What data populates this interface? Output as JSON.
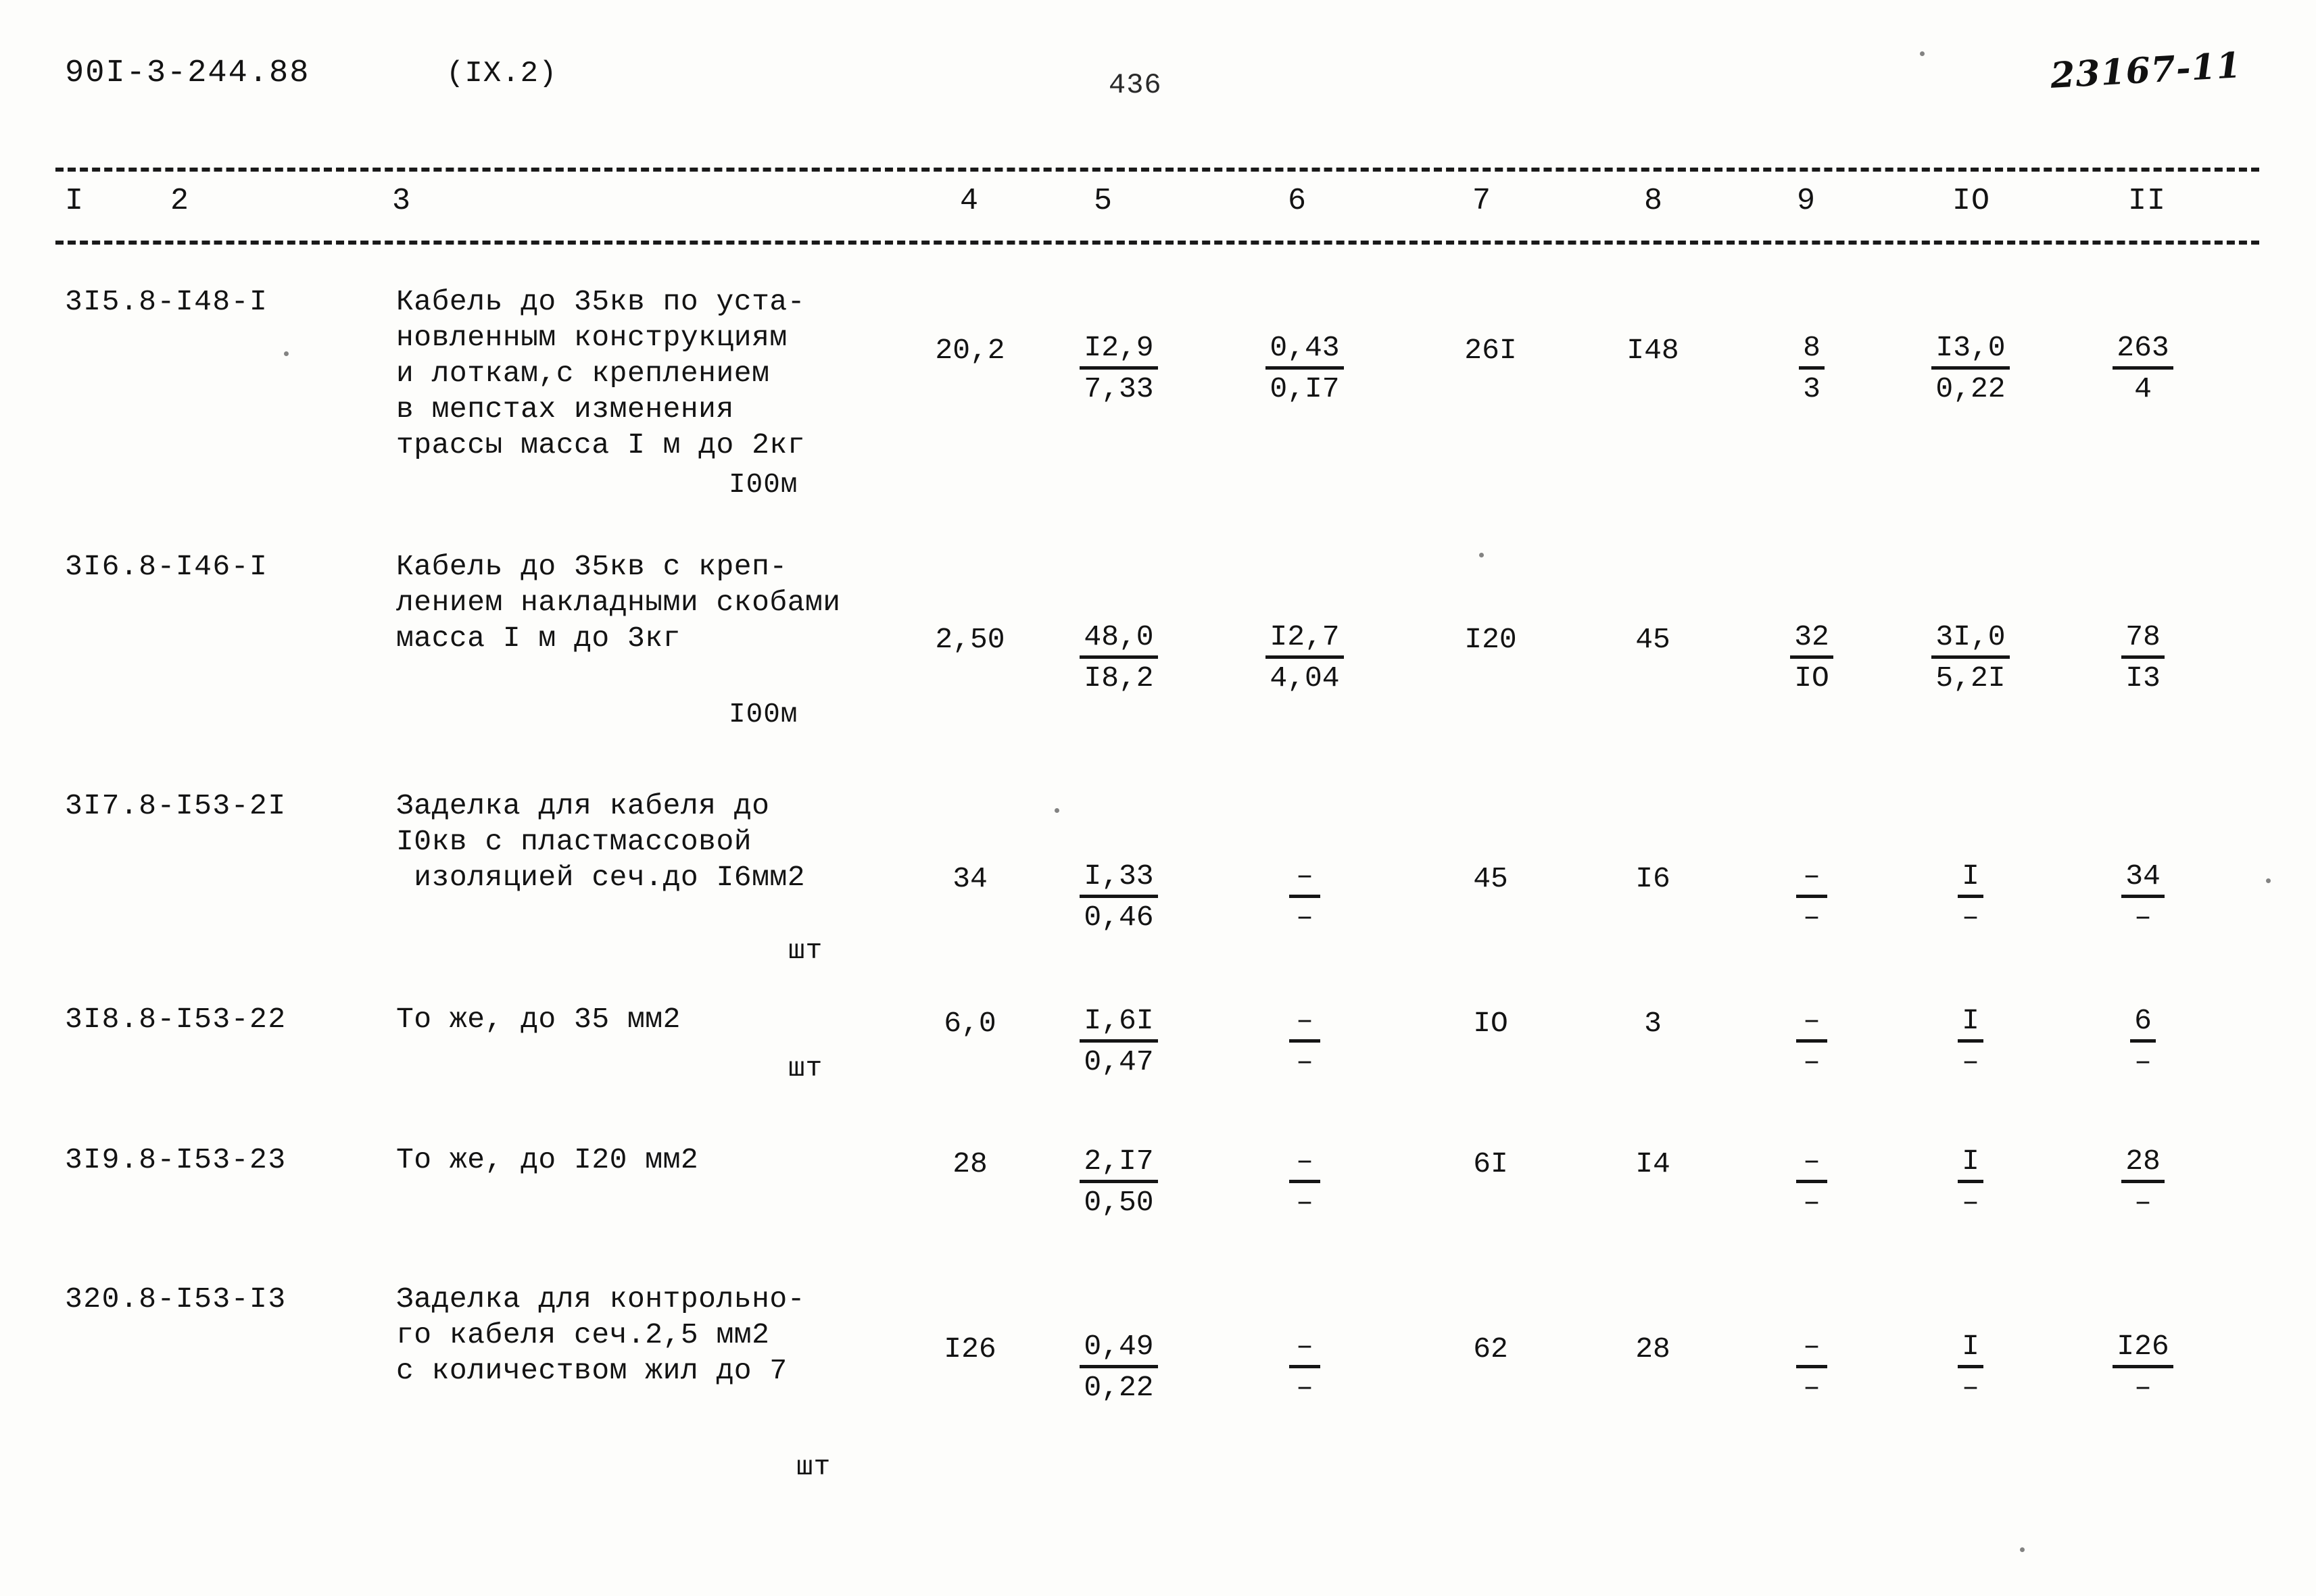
{
  "header": {
    "doc_code": "90I-3-244.88",
    "section": "(IX.2)",
    "page_number": "436",
    "hand_note": "23167-11"
  },
  "table": {
    "column_headers": [
      "I",
      "2",
      "3",
      "4",
      "5",
      "6",
      "7",
      "8",
      "9",
      "IO",
      "II"
    ],
    "rows": [
      {
        "code": "3I5.8-I48-I",
        "description": "Кабель до 35кв по уста-\nновленным конструкциям\nи лоткам,с креплением\nв мепстах изменения\nтрассы масса I м до 2кг",
        "unit": "I00м",
        "c4": "20,2",
        "c5_top": "I2,9",
        "c5_bot": "7,33",
        "c6_top": "0,43",
        "c6_bot": "0,I7",
        "c7": "26I",
        "c8": "I48",
        "c9_top": "8",
        "c9_bot": "3",
        "c10_top": "I3,0",
        "c10_bot": "0,22",
        "c11_top": "263",
        "c11_bot": "4"
      },
      {
        "code": "3I6.8-I46-I",
        "description": "Кабель до 35кв с креп-\nлением накладными скобами\nмасса I м до 3кг",
        "unit": "I00м",
        "c4": "2,50",
        "c5_top": "48,0",
        "c5_bot": "I8,2",
        "c6_top": "I2,7",
        "c6_bot": "4,04",
        "c7": "I20",
        "c8": "45",
        "c9_top": "32",
        "c9_bot": "IO",
        "c10_top": "3I,0",
        "c10_bot": "5,2I",
        "c11_top": "78",
        "c11_bot": "I3"
      },
      {
        "code": "3I7.8-I53-2I",
        "description": "Заделка для кабеля до\nI0кв с пластмассовой\n изоляцией сеч.до I6мм2",
        "unit": "шт",
        "c4": "34",
        "c5_top": "I,33",
        "c5_bot": "0,46",
        "c6_top": "–",
        "c6_bot": "–",
        "c7": "45",
        "c8": "I6",
        "c9_top": "–",
        "c9_bot": "–",
        "c10_top": "I",
        "c10_bot": "–",
        "c11_top": "34",
        "c11_bot": "–"
      },
      {
        "code": "3I8.8-I53-22",
        "description": "То же, до 35 мм2",
        "unit": "шт",
        "c4": "6,0",
        "c5_top": "I,6I",
        "c5_bot": "0,47",
        "c6_top": "–",
        "c6_bot": "–",
        "c7": "IO",
        "c8": "3",
        "c9_top": "–",
        "c9_bot": "–",
        "c10_top": "I",
        "c10_bot": "–",
        "c11_top": "6",
        "c11_bot": "–"
      },
      {
        "code": "3I9.8-I53-23",
        "description": "То же, до I20 мм2",
        "unit": "",
        "c4": "28",
        "c5_top": "2,I7",
        "c5_bot": "0,50",
        "c6_top": "–",
        "c6_bot": "–",
        "c7": "6I",
        "c8": "I4",
        "c9_top": "–",
        "c9_bot": "–",
        "c10_top": "I",
        "c10_bot": "–",
        "c11_top": "28",
        "c11_bot": "–"
      },
      {
        "code": "320.8-I53-I3",
        "description": "Заделка для контрольно-\nго кабеля сеч.2,5 мм2\nс количеством жил до 7",
        "unit": "шт",
        "c4": "I26",
        "c5_top": "0,49",
        "c5_bot": "0,22",
        "c6_top": "–",
        "c6_bot": "–",
        "c7": "62",
        "c8": "28",
        "c9_top": "–",
        "c9_bot": "–",
        "c10_top": "I",
        "c10_bot": "–",
        "c11_top": "I26",
        "c11_bot": "–"
      }
    ]
  }
}
